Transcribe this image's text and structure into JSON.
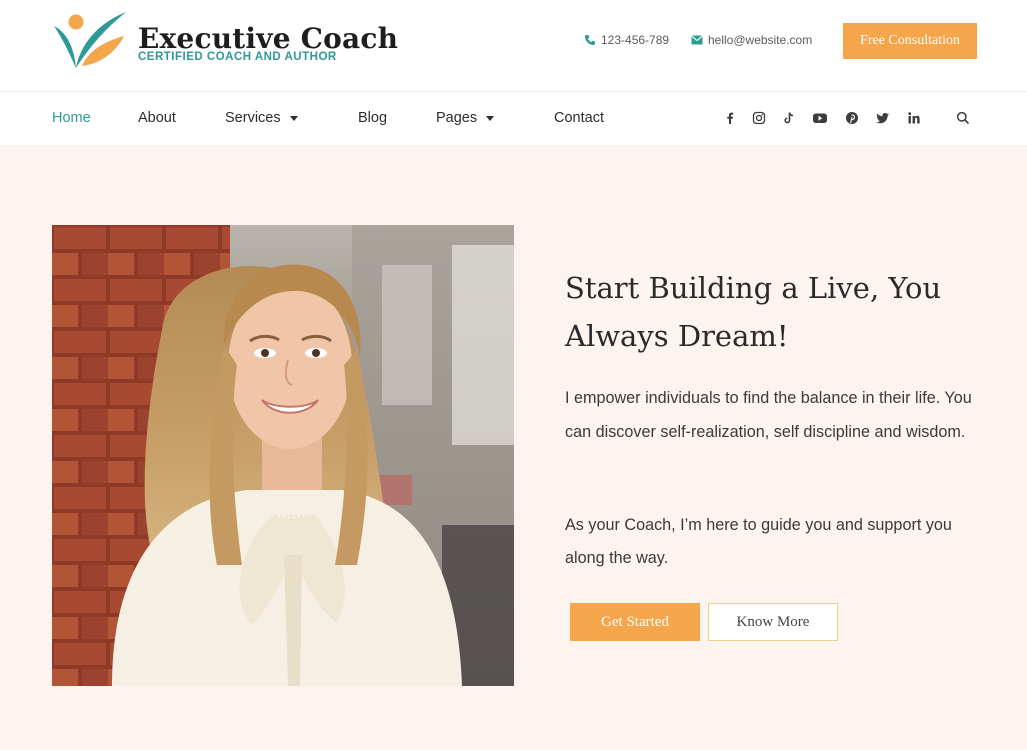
{
  "header": {
    "logo_title": "Executive Coach",
    "logo_subtitle": "CERTIFIED COACH AND AUTHOR",
    "phone": "123-456-789",
    "email": "hello@website.com",
    "cta_label": "Free Consultation"
  },
  "nav": {
    "items": [
      {
        "label": "Home",
        "active": true
      },
      {
        "label": "About"
      },
      {
        "label": "Services",
        "has_dropdown": true
      },
      {
        "label": "Blog"
      },
      {
        "label": "Pages",
        "has_dropdown": true
      },
      {
        "label": "Contact"
      }
    ],
    "social": [
      "facebook-icon",
      "instagram-icon",
      "tiktok-icon",
      "youtube-icon",
      "pinterest-icon",
      "twitter-icon",
      "linkedin-icon"
    ],
    "search_icon": "search-icon"
  },
  "hero": {
    "title": "Start Building a Live, You Always Dream!",
    "paragraph1": "I empower individuals to find the balance in their life. You can discover self-realization, self discipline and wisdom.",
    "paragraph2": "As your Coach, I’m here to guide you and support you along the way.",
    "primary_button": "Get Started",
    "secondary_button": "Know More"
  },
  "colors": {
    "accent_orange": "#f5a54a",
    "accent_teal": "#2e9a96",
    "hero_background": "#fdf4ef"
  }
}
